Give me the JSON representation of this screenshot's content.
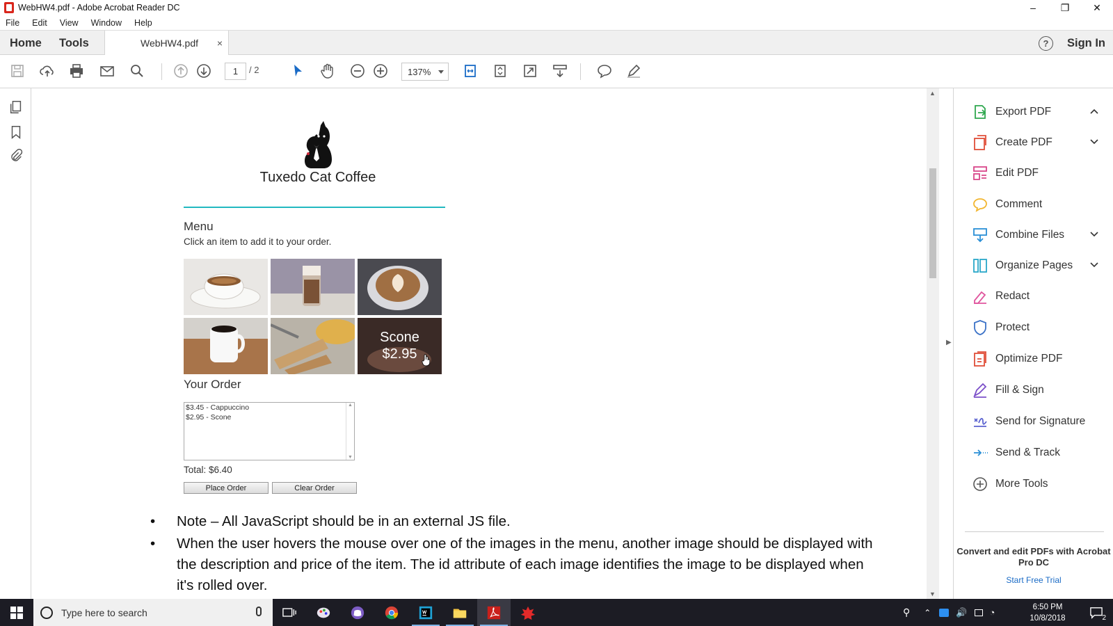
{
  "window": {
    "title": "WebHW4.pdf - Adobe Acrobat Reader DC",
    "minimize": "–",
    "restore": "❐",
    "close": "✕"
  },
  "menu": [
    "File",
    "Edit",
    "View",
    "Window",
    "Help"
  ],
  "tabs": {
    "home": "Home",
    "tools": "Tools",
    "document": "WebHW4.pdf",
    "close": "×",
    "help": "?",
    "signin": "Sign In"
  },
  "toolbar": {
    "page_current": "1",
    "page_total": "/ 2",
    "zoom": "137%"
  },
  "document": {
    "brand": "Tuxedo Cat Coffee",
    "menu_title": "Menu",
    "menu_sub": "Click an item to add it to your order.",
    "hover_tile": {
      "name": "Scone",
      "price": "$2.95"
    },
    "order_title": "Your Order",
    "order_lines": [
      "$3.45 - Cappuccino",
      "$2.95 - Scone"
    ],
    "total": "Total: $6.40",
    "place_order": "Place Order",
    "clear_order": "Clear Order",
    "bullets": [
      "Note – All JavaScript should be in an external JS file.",
      "When the user hovers the mouse over one of the images in the menu, another image should be displayed with",
      "the description and price of the item. The id attribute of each image identifies the image to be displayed when",
      "it's rolled over."
    ]
  },
  "tools_panel": {
    "items": [
      {
        "label": "Export PDF",
        "icon": "export-pdf-icon",
        "color": "#2fa84f",
        "chevron": "up"
      },
      {
        "label": "Create PDF",
        "icon": "create-pdf-icon",
        "color": "#e04e39",
        "chevron": "down"
      },
      {
        "label": "Edit PDF",
        "icon": "edit-pdf-icon",
        "color": "#d9478a",
        "chevron": ""
      },
      {
        "label": "Comment",
        "icon": "comment-icon",
        "color": "#f2b630",
        "chevron": ""
      },
      {
        "label": "Combine Files",
        "icon": "combine-files-icon",
        "color": "#2a8fd6",
        "chevron": "down"
      },
      {
        "label": "Organize Pages",
        "icon": "organize-pages-icon",
        "color": "#2aa8c9",
        "chevron": "down"
      },
      {
        "label": "Redact",
        "icon": "redact-icon",
        "color": "#e0559e",
        "chevron": ""
      },
      {
        "label": "Protect",
        "icon": "protect-icon",
        "color": "#3b72c7",
        "chevron": ""
      },
      {
        "label": "Optimize PDF",
        "icon": "optimize-pdf-icon",
        "color": "#e04e39",
        "chevron": ""
      },
      {
        "label": "Fill & Sign",
        "icon": "fill-sign-icon",
        "color": "#7b4fc9",
        "chevron": ""
      },
      {
        "label": "Send for Signature",
        "icon": "send-signature-icon",
        "color": "#5b63d0",
        "chevron": ""
      },
      {
        "label": "Send & Track",
        "icon": "send-track-icon",
        "color": "#2a8fd6",
        "chevron": ""
      },
      {
        "label": "More Tools",
        "icon": "more-tools-icon",
        "color": "#555555",
        "chevron": ""
      }
    ],
    "promo": "Convert and edit PDFs with Acrobat Pro DC",
    "promo_link": "Start Free Trial"
  },
  "taskbar": {
    "search_placeholder": "Type here to search",
    "time": "6:50 PM",
    "date": "10/8/2018",
    "notifications": "2"
  }
}
